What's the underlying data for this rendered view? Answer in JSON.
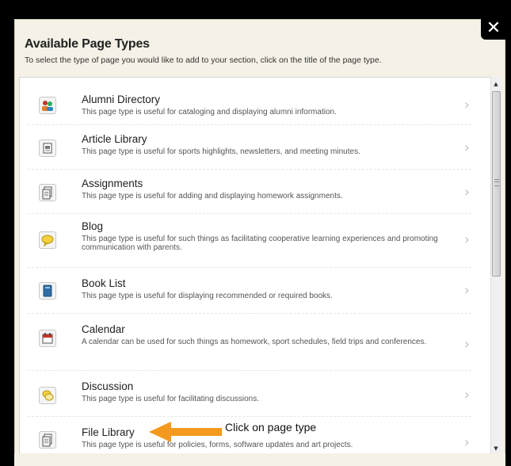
{
  "dialog": {
    "title": "Available Page Types",
    "subtitle": "To select the type of page you would like to add to your section, click on the title of the page type.",
    "close_label": "✕"
  },
  "items": [
    {
      "name": "Alumni Directory",
      "desc": "This page type is useful for cataloging and displaying alumni information.",
      "icon": "people-icon"
    },
    {
      "name": "Article Library",
      "desc": "This page type is useful for sports highlights, newsletters, and meeting minutes.",
      "icon": "article-icon"
    },
    {
      "name": "Assignments",
      "desc": "This page type is useful for adding and displaying homework assignments.",
      "icon": "clipboard-icon"
    },
    {
      "name": "Blog",
      "desc": "This page type is useful for such things as facilitating cooperative learning experiences and promoting communication with parents.",
      "icon": "speech-bubble-icon"
    },
    {
      "name": "Book List",
      "desc": "This page type is useful for displaying recommended or required books.",
      "icon": "book-icon"
    },
    {
      "name": "Calendar",
      "desc": "A calendar can be used for such things as homework, sport schedules, field trips and conferences.",
      "icon": "calendar-icon"
    },
    {
      "name": "Discussion",
      "desc": "This page type is useful for facilitating discussions.",
      "icon": "discussion-icon"
    },
    {
      "name": "File Library",
      "desc": "This page type is useful for policies, forms, software updates and art projects.",
      "icon": "file-icon"
    }
  ],
  "chevron": "›",
  "callout": {
    "text": "Click on page type",
    "arrow_color": "#f39a1e"
  },
  "colors": {
    "dialog_bg": "#f5f1e6",
    "backdrop": "#000000"
  }
}
